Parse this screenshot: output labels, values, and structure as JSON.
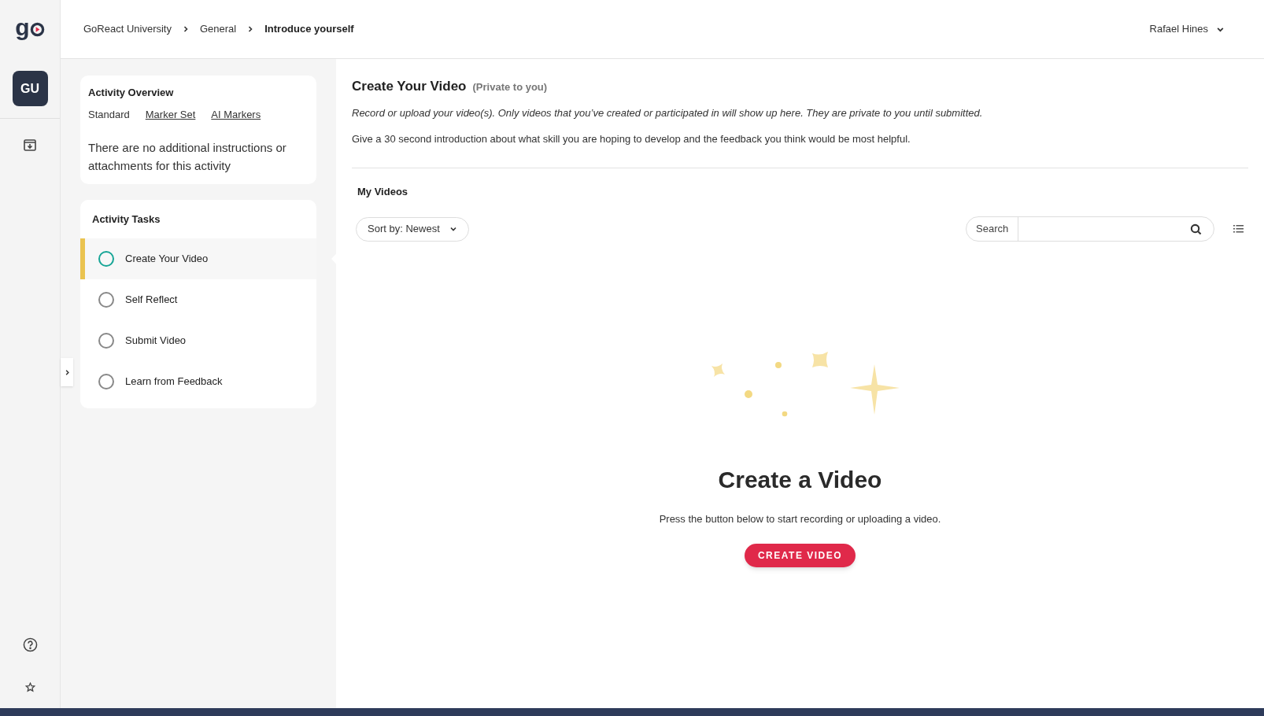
{
  "logo": "g",
  "rail": {
    "avatar": "GU"
  },
  "breadcrumbs": [
    {
      "label": "GoReact University",
      "current": false
    },
    {
      "label": "General",
      "current": false
    },
    {
      "label": "Introduce yourself",
      "current": true
    }
  ],
  "user": {
    "name": "Rafael Hines"
  },
  "overview": {
    "title": "Activity Overview",
    "tabs": [
      {
        "label": "Standard",
        "kind": "text"
      },
      {
        "label": "Marker Set",
        "kind": "link"
      },
      {
        "label": "AI Markers",
        "kind": "link"
      }
    ],
    "text": "There are no additional instructions or attachments for this activity"
  },
  "tasks": {
    "title": "Activity Tasks",
    "items": [
      {
        "label": "Create Your Video",
        "selected": true
      },
      {
        "label": "Self Reflect",
        "selected": false
      },
      {
        "label": "Submit Video",
        "selected": false
      },
      {
        "label": "Learn from Feedback",
        "selected": false
      }
    ]
  },
  "main": {
    "title": "Create Your Video",
    "subtitle": "(Private to you)",
    "note": "Record or upload your video(s). Only videos that you’ve created or participated in will show up here. They are private to you until submitted.",
    "instructions": "Give a 30 second introduction about what skill you are hoping to develop and the feedback you think would be most helpful.",
    "section": "My Videos",
    "sort": "Sort by: Newest",
    "search_label": "Search"
  },
  "empty": {
    "title": "Create a Video",
    "text": "Press the button below to start recording or uploading a video.",
    "button": "CREATE VIDEO"
  }
}
